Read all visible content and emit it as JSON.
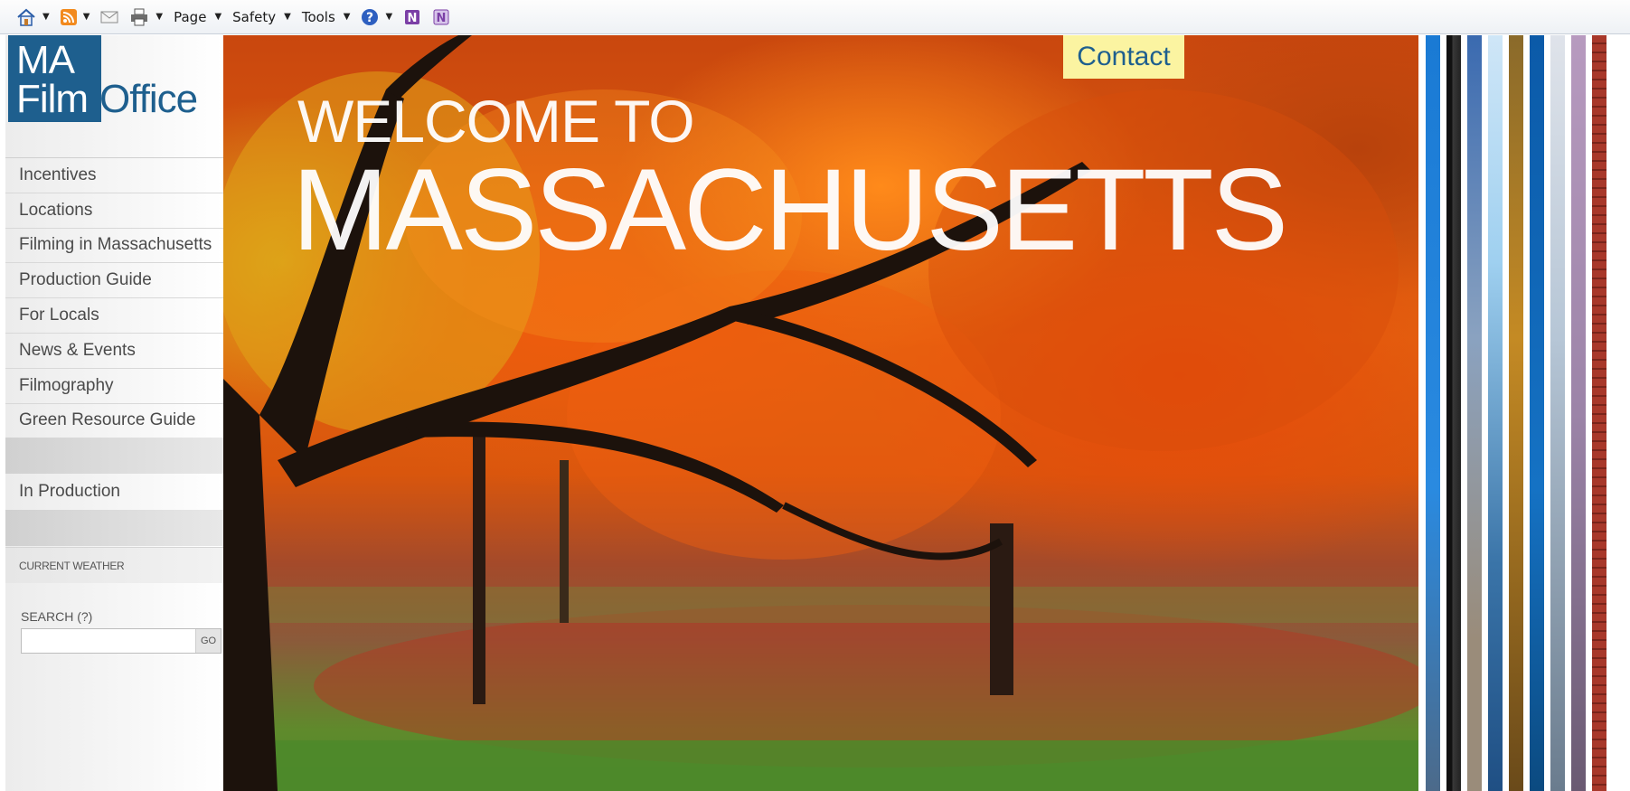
{
  "toolbar": {
    "page_label": "Page",
    "safety_label": "Safety",
    "tools_label": "Tools"
  },
  "sidebar": {
    "logo": {
      "ma": "MA",
      "film": "Film",
      "office": "Office"
    },
    "items": [
      {
        "label": "Incentives"
      },
      {
        "label": "Locations"
      },
      {
        "label": "Filming in Massachusetts"
      },
      {
        "label": "Production Guide"
      },
      {
        "label": "For Locals"
      },
      {
        "label": "News & Events"
      },
      {
        "label": "Filmography"
      },
      {
        "label": "Green Resource Guide"
      }
    ],
    "in_production": "In Production",
    "weather": "CURRENT WEATHER",
    "search": {
      "label": "SEARCH (?)",
      "value": "",
      "go": "GO"
    }
  },
  "hero": {
    "welcome": "WELCOME TO",
    "state": "MASSACHUSETTS",
    "contact": "Contact"
  },
  "colors": {
    "brand_blue": "#1e5f8e",
    "contact_bg": "#fbf4a1"
  }
}
